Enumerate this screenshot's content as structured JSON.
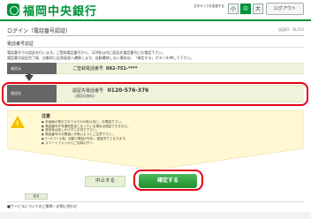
{
  "header": {
    "bank_name": "福岡中央銀行",
    "font_size_label": "文字サイズを変更する",
    "font_sizes": [
      "小",
      "中",
      "大"
    ],
    "logout": "ログアウト"
  },
  "title": {
    "text": "ログイン（電話番号認証）",
    "page_id": "画面ID：BL050"
  },
  "section": {
    "title": "電話番号認証",
    "description": [
      "電話番号での認証を行います。ご登録電話番号から、120秒以内に認証先電話番号にお電話下さい。",
      "電話番号認証完了後、自動的に応答画面へ遷移します。自動遷移しない場合は、「確定する」ボタンを押して下さい。"
    ]
  },
  "rows": {
    "registered": {
      "label": "発信元",
      "caption": "ご登録電話番号",
      "number": "092-751-****"
    },
    "auth": {
      "label": "発信先",
      "caption": "認証先電話番号",
      "number": "0120-576-376",
      "note": "（通話料無料）"
    }
  },
  "notice": {
    "title": "注意",
    "items": [
      "本画面が表示されてから120秒以内に、お電話下さい。",
      "電話番号が非通知設定となっている場合は認証できません。",
      "発信後は話しかけずにお切り下さい。",
      "電話番号のお間違いが無いようにご注意下さい。",
      "2～3コール後、自動で電話が切れ、認証完了となります。",
      "スマートフォンからご利用の方へ"
    ]
  },
  "buttons": {
    "back": "中止する",
    "confirm": "確定する",
    "back_small": "戻る"
  },
  "footer": {
    "link": "■サービスについてのご質問・お問い合わせ"
  },
  "colors": {
    "brand_green": "#00913a",
    "highlight_red": "#e50012",
    "notice_bg": "#fff8d2",
    "row_bg": "#eef4dc"
  }
}
